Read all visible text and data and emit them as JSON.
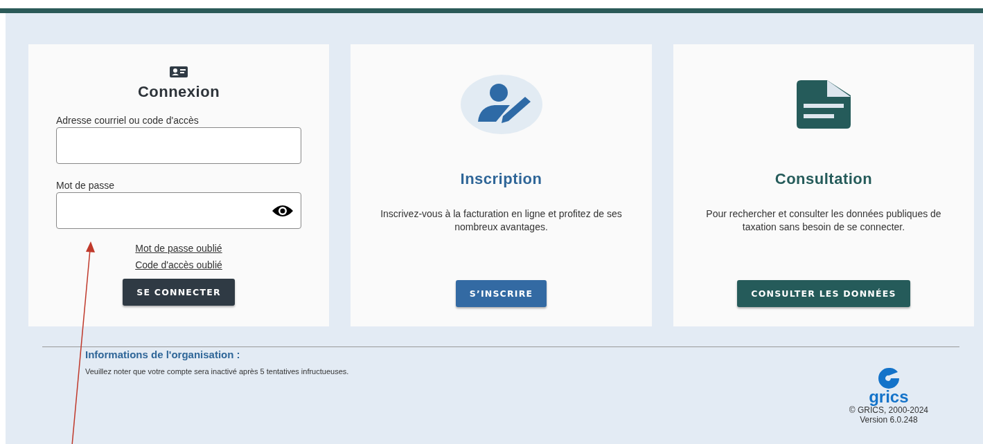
{
  "cards": [
    {
      "kind": "login",
      "title": "Connexion",
      "fields": [
        {
          "label": "Adresse courriel ou code d'accès",
          "kind": "text"
        },
        {
          "label": "Mot de passe",
          "kind": "password"
        }
      ],
      "links": [
        "Mot de passe oublié",
        "Code d'accès oublié"
      ],
      "button": "SE CONNECTER"
    },
    {
      "kind": "signup",
      "title": "Inscription",
      "description": "Inscrivez-vous à la facturation en ligne et profitez de ses nombreux avantages.",
      "button": "S’INSCRIRE"
    },
    {
      "kind": "consult",
      "title": "Consultation",
      "description": "Pour rechercher et consulter les données publiques de taxation sans besoin de se connecter.",
      "button": "CONSULTER LES DONNÉES"
    }
  ],
  "footer": {
    "heading": "Informations de l'organisation :",
    "notice": "Veuillez noter que votre compte sera inactivé après 5 tentatives infructueuses.",
    "brand": "grics",
    "copyright": "© GRICS, 2000-2024",
    "version": "Version 6.0.248"
  }
}
